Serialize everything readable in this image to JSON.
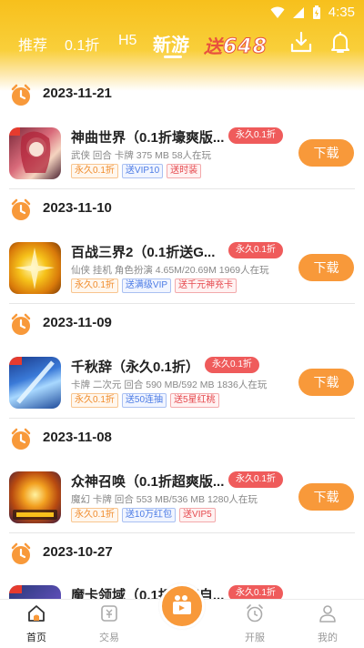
{
  "status": {
    "time": "4:35"
  },
  "nav": {
    "tabs": [
      {
        "label": "推荐"
      },
      {
        "label": "0.1折"
      },
      {
        "label": "H5"
      },
      {
        "label": "新游"
      }
    ],
    "promo_prefix": "送",
    "promo_number": "648"
  },
  "sections": [
    {
      "date": "2023-11-21",
      "game": {
        "title": "神曲世界（0.1折壕爽版...",
        "badge": "永久0.1折",
        "meta": "武侠 回合 卡牌 375 MB 58人在玩",
        "tags": [
          "永久0.1折",
          "送VIP10",
          "送时装"
        ],
        "button": "下载"
      }
    },
    {
      "date": "2023-11-10",
      "game": {
        "title": "百战三界2（0.1折送G...",
        "badge": "永久0.1折",
        "meta": "仙侠 挂机 角色扮演 4.65M/20.69M 1969人在玩",
        "tags": [
          "永久0.1折",
          "送满级VIP",
          "送千元神充卡"
        ],
        "button": "下载"
      }
    },
    {
      "date": "2023-11-09",
      "game": {
        "title": "千秋辞（永久0.1折）",
        "badge": "永久0.1折",
        "meta": "卡牌 二次元 回合 590 MB/592 MB 1836人在玩",
        "tags": [
          "永久0.1折",
          "送50连抽",
          "送5星红桃"
        ],
        "button": "下载"
      }
    },
    {
      "date": "2023-11-08",
      "game": {
        "title": "众神召唤（0.1折超爽版...",
        "badge": "永久0.1折",
        "meta": "魔幻 卡牌 回合 553 MB/536 MB 1280人在玩",
        "tags": [
          "永久0.1折",
          "送10万红包",
          "送VIP5"
        ],
        "button": "下载"
      }
    },
    {
      "date": "2023-10-27",
      "game": {
        "title": "魔卡领域（0.1折光暗自...",
        "badge": "永久0.1折"
      }
    }
  ],
  "bottom_nav": [
    {
      "label": "首页",
      "icon": "home-icon"
    },
    {
      "label": "交易",
      "icon": "trade-icon"
    },
    {
      "label": "",
      "icon": "video-icon"
    },
    {
      "label": "开服",
      "icon": "alarm-icon"
    },
    {
      "label": "我的",
      "icon": "profile-icon"
    }
  ],
  "colors": {
    "accent": "#f8993a",
    "header": "#f7c01c",
    "badge": "#ef5b5b"
  }
}
